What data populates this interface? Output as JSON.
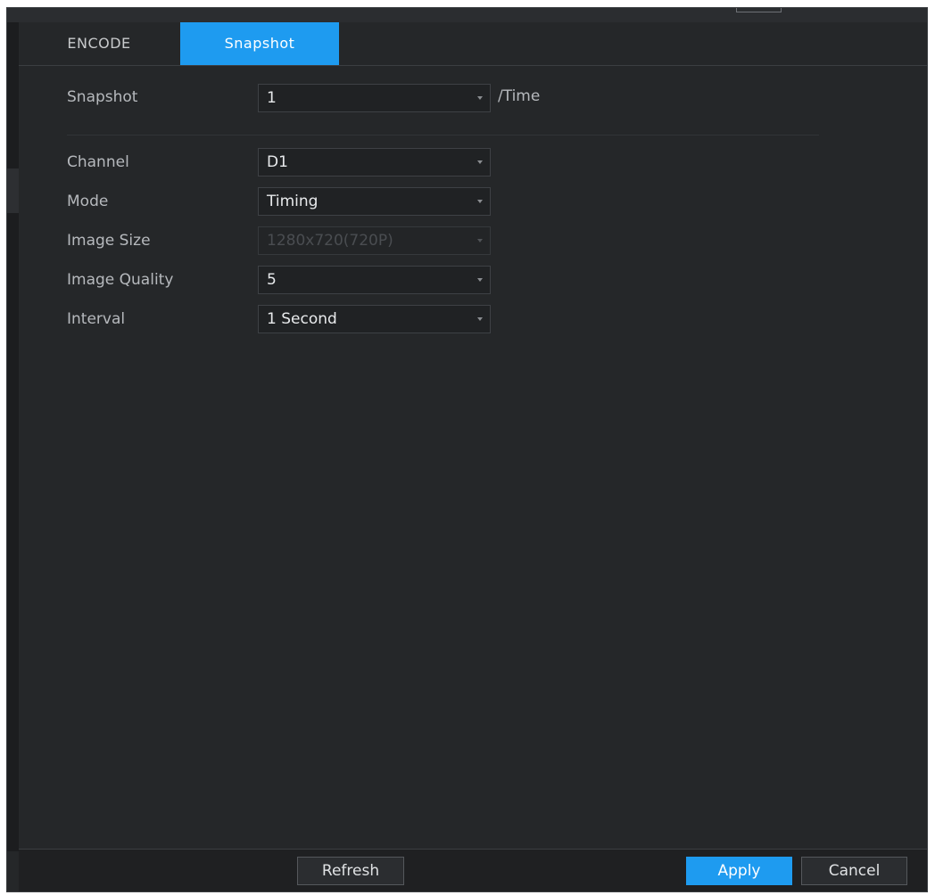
{
  "tabs": [
    {
      "label": "ENCODE",
      "active": false
    },
    {
      "label": "Snapshot",
      "active": true
    }
  ],
  "snapshot_row": {
    "label": "Snapshot",
    "value": "1",
    "suffix": "/Time"
  },
  "fields": [
    {
      "label": "Channel",
      "value": "D1",
      "disabled": false
    },
    {
      "label": "Mode",
      "value": "Timing",
      "disabled": false
    },
    {
      "label": "Image Size",
      "value": "1280x720(720P)",
      "disabled": true
    },
    {
      "label": "Image Quality",
      "value": "5",
      "disabled": false
    },
    {
      "label": "Interval",
      "value": "1 Second",
      "disabled": false
    }
  ],
  "footer": {
    "refresh_label": "Refresh",
    "apply_label": "Apply",
    "cancel_label": "Cancel"
  },
  "colors": {
    "accent": "#1e9bf0",
    "panel_bg": "#252729"
  }
}
